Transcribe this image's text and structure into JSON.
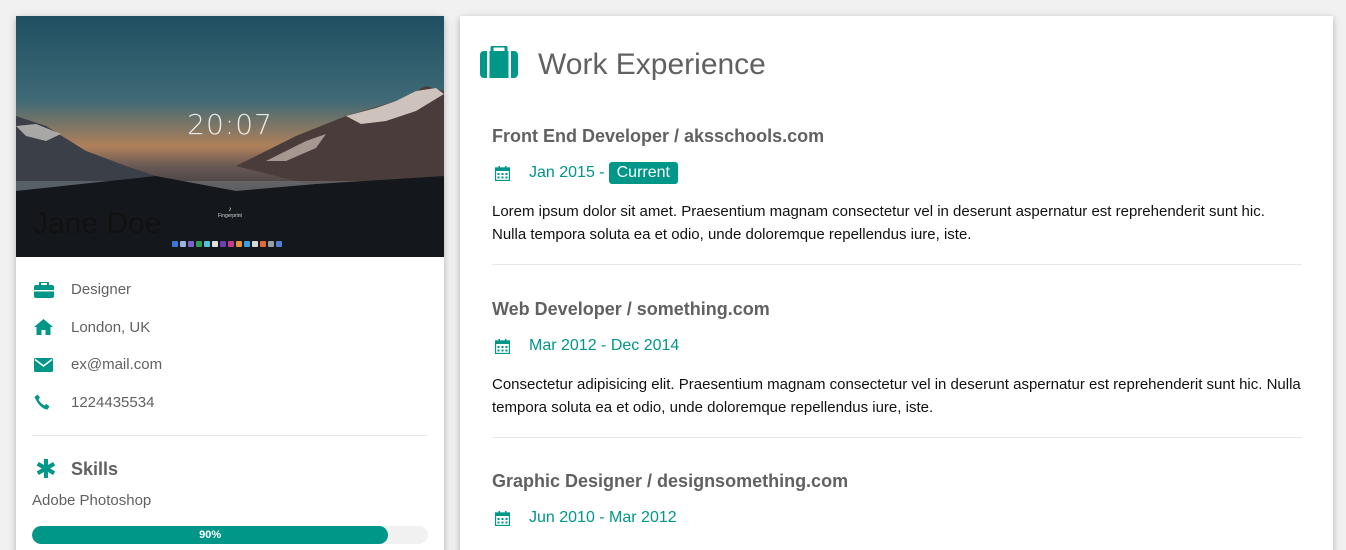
{
  "profile": {
    "name": "Jane Doe",
    "lock_clock": "20:07",
    "lock_caption": "Fingerprint",
    "info": [
      {
        "icon": "briefcase-icon",
        "text": "Designer"
      },
      {
        "icon": "home-icon",
        "text": "London, UK"
      },
      {
        "icon": "envelope-icon",
        "text": "ex@mail.com"
      },
      {
        "icon": "phone-icon",
        "text": "1224435534"
      }
    ],
    "skills_title": "Skills",
    "skills": [
      {
        "name": "Adobe Photoshop",
        "percent": 90,
        "label": "90%"
      }
    ]
  },
  "work": {
    "title": "Work Experience",
    "jobs": [
      {
        "title": "Front End Developer / aksschools.com",
        "start": "Jan 2015 -",
        "end_badge": "Current",
        "description": "Lorem ipsum dolor sit amet. Praesentium magnam consectetur vel in deserunt aspernatur est reprehenderit sunt hic. Nulla tempora soluta ea et odio, unde doloremque repellendus iure, iste."
      },
      {
        "title": "Web Developer / something.com",
        "start": "Mar 2012 - Dec 2014",
        "description": "Consectetur adipisicing elit. Praesentium magnam consectetur vel in deserunt aspernatur est reprehenderit sunt hic. Nulla tempora soluta ea et odio, unde doloremque repellendus iure, iste."
      },
      {
        "title": "Graphic Designer / designsomething.com",
        "start": "Jun 2010 - Mar 2012",
        "description": ""
      }
    ]
  },
  "colors": {
    "accent": "#009688",
    "text": "#616161",
    "background": "#f1f1f1"
  }
}
